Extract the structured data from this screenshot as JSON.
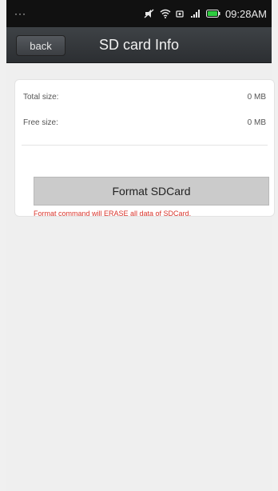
{
  "status_bar": {
    "overflow": "···",
    "time": "09:28AM",
    "icons": [
      "mute-icon",
      "wifi-icon",
      "sim-icon",
      "signal-icon",
      "battery-icon"
    ]
  },
  "header": {
    "back_label": "back",
    "title": "SD card Info"
  },
  "sd_info": {
    "total_label": "Total size:",
    "total_value": "0 MB",
    "free_label": "Free size:",
    "free_value": "0 MB"
  },
  "actions": {
    "format_label": "Format SDCard",
    "warning": "Format command will ERASE all data of SDCard."
  },
  "colors": {
    "warning": "#d9342b",
    "battery": "#2ecc40"
  }
}
